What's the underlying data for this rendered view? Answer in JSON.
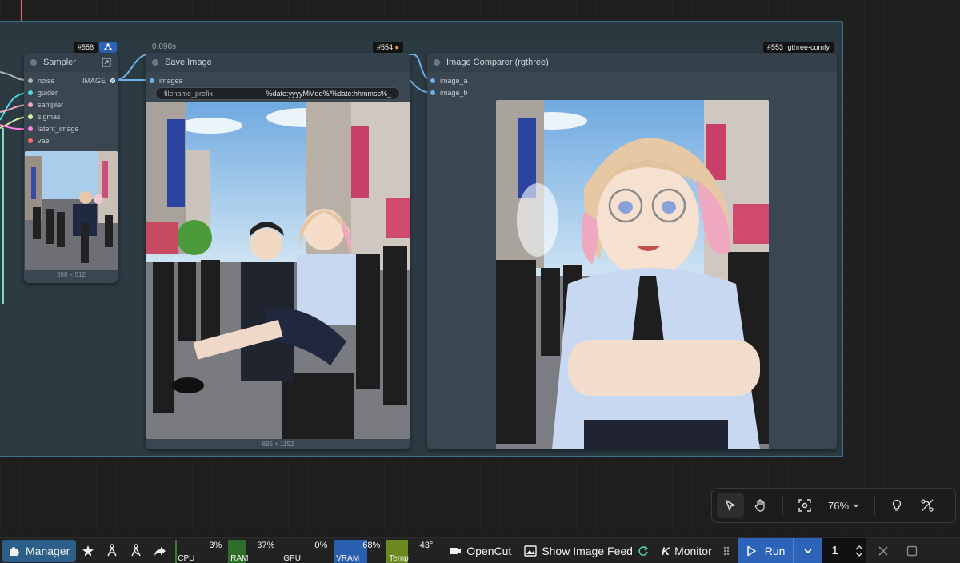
{
  "nodes": {
    "sampler": {
      "id_badge": "#558",
      "title": "Sampler",
      "inputs": [
        {
          "label": "noise",
          "color": "#b0b0b0"
        },
        {
          "label": "guider",
          "color": "#4fd8e8"
        },
        {
          "label": "sampler",
          "color": "#f0a8b8"
        },
        {
          "label": "sigmas",
          "color": "#d8f0a0"
        },
        {
          "label": "latent_image",
          "color": "#ff7ee0"
        },
        {
          "label": "vae",
          "color": "#ff6e6e"
        }
      ],
      "output_label": "IMAGE",
      "preview_size": "398 × 512"
    },
    "save_image": {
      "id_badge": "#554",
      "time": "0.090s",
      "title": "Save Image",
      "input_label": "images",
      "widget_name": "filename_prefix",
      "widget_value": "%date:yyyyMMdd%/%date:hhmmss%_",
      "preview_size": "896 × 1152"
    },
    "comparer": {
      "id_badge": "#553 rgthree-comfy",
      "title": "Image Comparer (rgthree)",
      "input_a": "image_a",
      "input_b": "image_b"
    }
  },
  "zoombar": {
    "zoom_level": "76%"
  },
  "taskbar": {
    "manager_label": "Manager",
    "meters": [
      {
        "label": "CPU",
        "value": "3%",
        "percent": 3,
        "color": "#3a7a30"
      },
      {
        "label": "RAM",
        "value": "37%",
        "percent": 37,
        "color": "#2f6e2a"
      },
      {
        "label": "GPU",
        "value": "0%",
        "percent": 0,
        "color": "#3a7a30"
      },
      {
        "label": "VRAM",
        "value": "68%",
        "percent": 68,
        "color": "#2a5fb0"
      },
      {
        "label": "Temp",
        "value": "43°",
        "percent": 43,
        "color": "#6a8a20"
      }
    ],
    "opencut_label": "OpenCut",
    "image_feed_label": "Show Image Feed",
    "monitor_label": "Monitor",
    "run_label": "Run",
    "queue_count": "1"
  }
}
